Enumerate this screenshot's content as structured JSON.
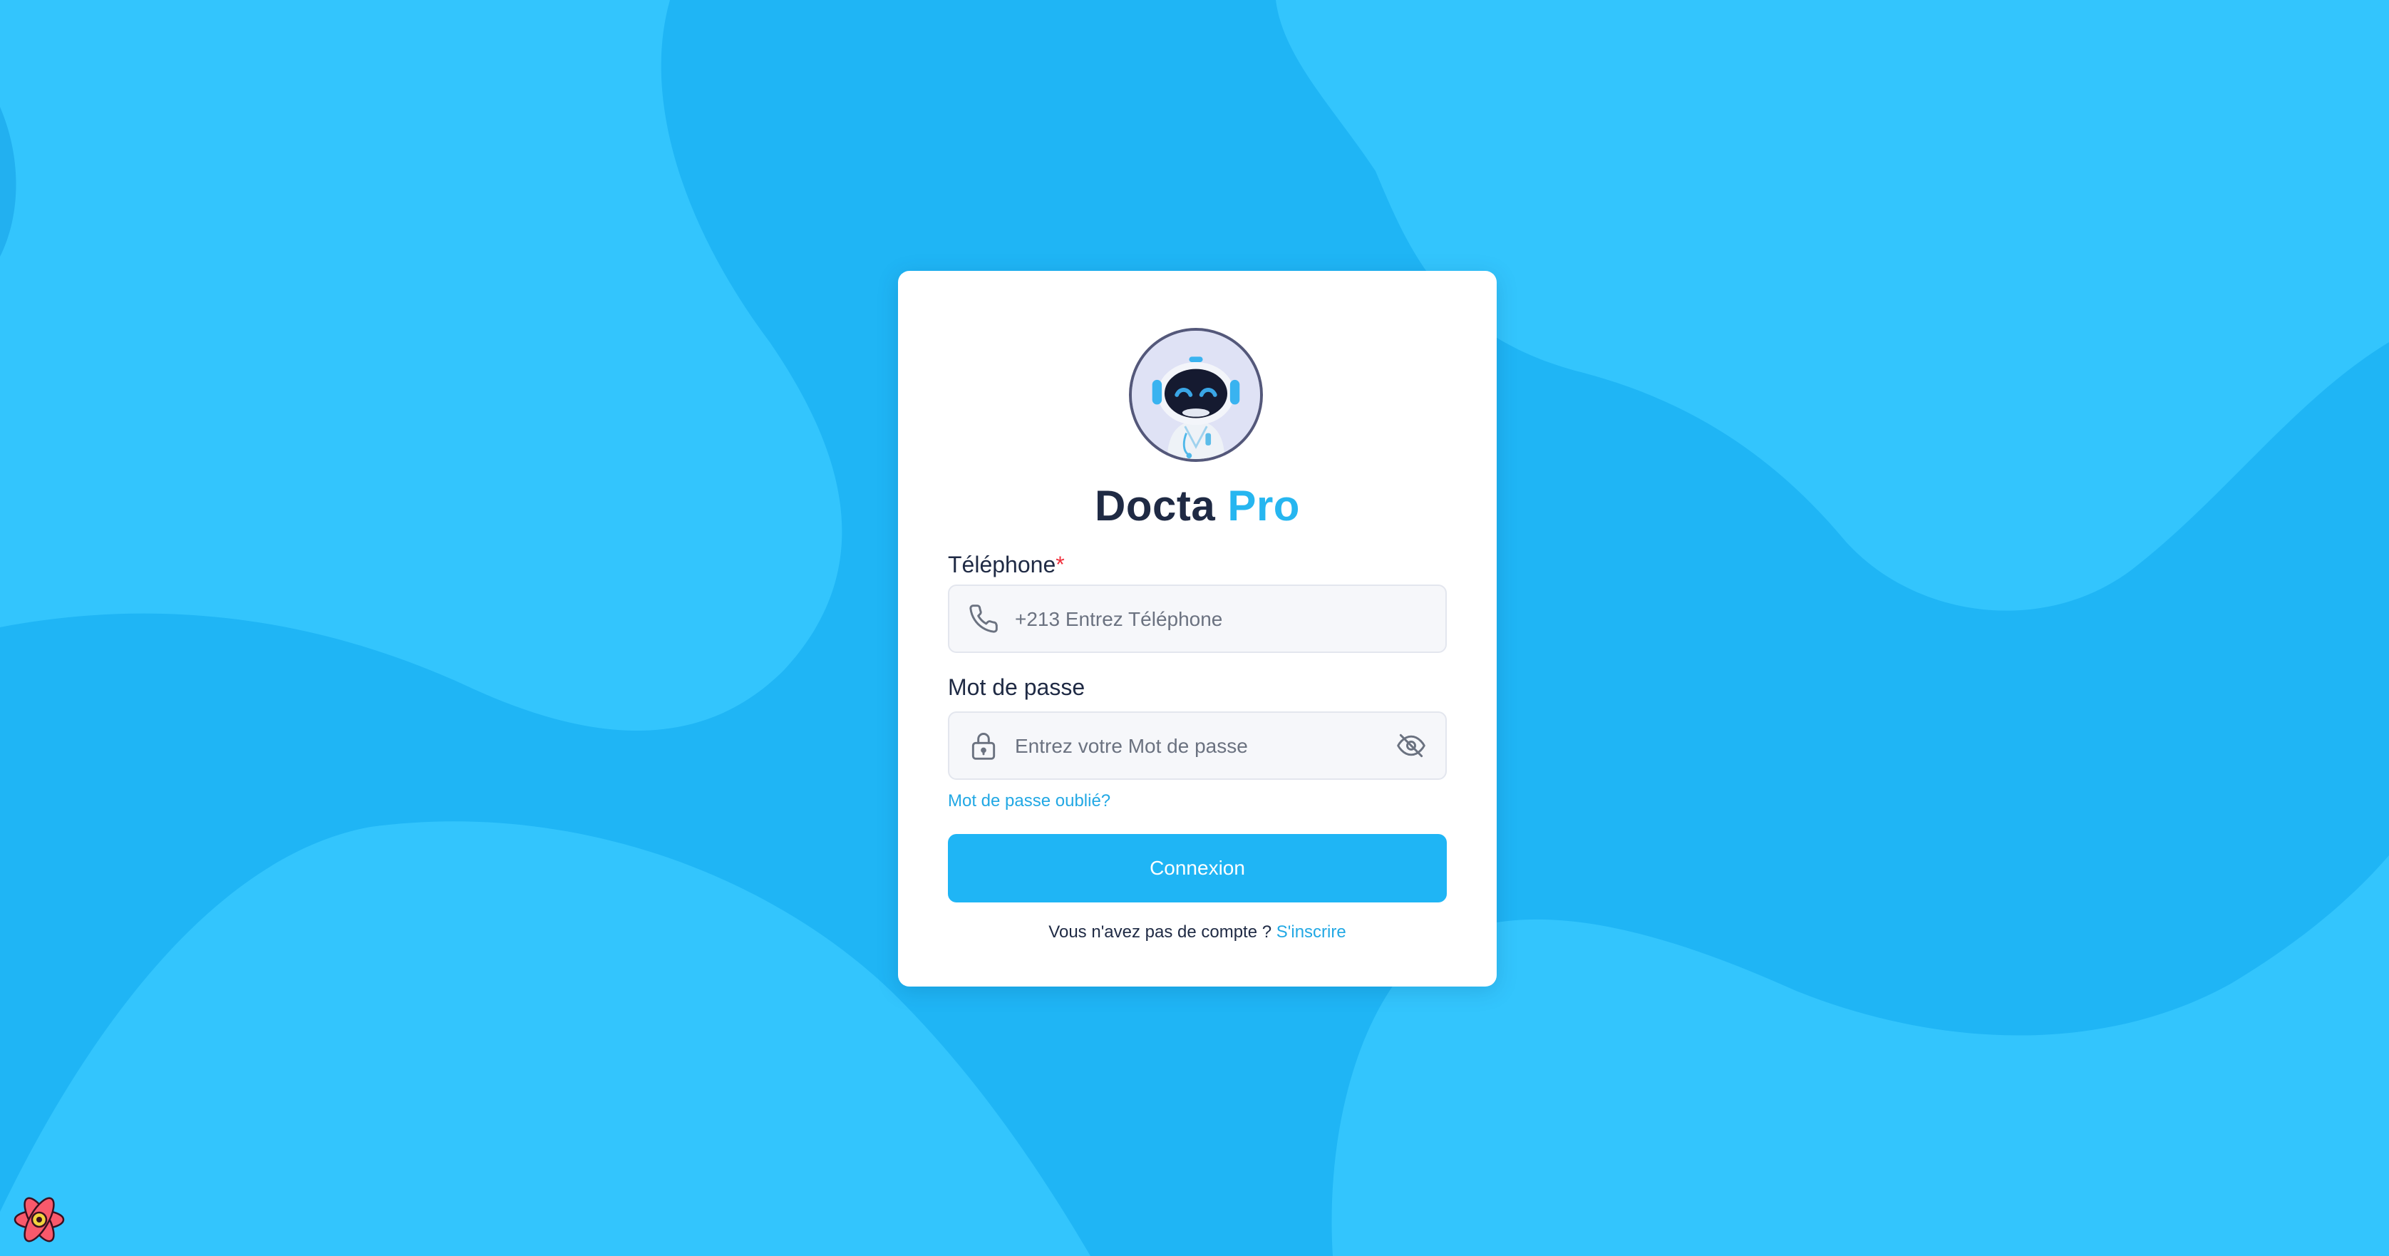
{
  "brand": {
    "name_dark": "Docta",
    "name_accent": "Pro"
  },
  "colors": {
    "background": "#1fb5f5",
    "background_light": "#33c5fd",
    "accent": "#26b6f0",
    "text_dark": "#1f2a44",
    "required": "#f0303c"
  },
  "form": {
    "phone": {
      "label": "Téléphone",
      "required_mark": "*",
      "placeholder": "+213 Entrez Téléphone",
      "value": "",
      "icon": "phone-icon"
    },
    "password": {
      "label": "Mot de passe",
      "placeholder": "Entrez votre Mot de passe",
      "value": "",
      "icon": "lock-icon",
      "toggle_icon": "eye-off-icon"
    },
    "forgot_link": "Mot de passe oublié?",
    "submit_label": "Connexion",
    "signup_prompt": "Vous n'avez pas de compte ?",
    "signup_link": "S'inscrire"
  },
  "icons": {
    "avatar": "robot-doctor-avatar-icon",
    "corner_badge": "react-logo-icon"
  }
}
